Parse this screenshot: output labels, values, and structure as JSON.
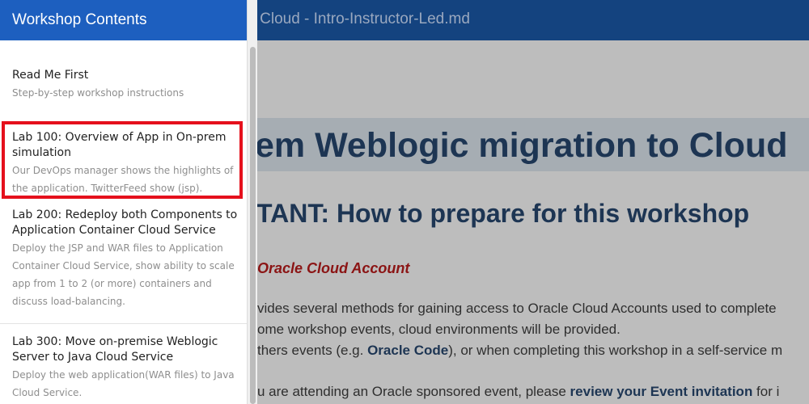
{
  "page": {
    "title": "to Cloud - Intro-Instructor-Led.md",
    "h1": "em Weblogic migration to Cloud",
    "h2": "TANT: How to prepare for this workshop",
    "h3": "Oracle Cloud Account",
    "p1": "vides several methods for gaining access to Oracle Cloud Accounts used to complete",
    "p2": "ome workshop events, cloud environments will be provided.",
    "p3_a": "thers events (e.g. ",
    "p3_b": "Oracle Code",
    "p3_c": "), or when completing this workshop in a self-service m",
    "p4_a": "u are attending an Oracle sponsored event, please ",
    "p4_b": "review your Event invitation",
    "p4_c": " for i"
  },
  "sidebar": {
    "header": "Workshop Contents",
    "items": [
      {
        "title": "Read Me First",
        "desc": "Step-by-step workshop instructions"
      },
      {
        "title": "Lab 100: Overview of App in On-prem simulation",
        "desc": "Our DevOps manager shows the highlights of the application. TwitterFeed show (jsp)."
      },
      {
        "title": "Lab 200: Redeploy both Components to Application Container Cloud Service",
        "desc": "Deploy the JSP and WAR files to Application Container Cloud Service, show ability to scale app from 1 to 2 (or more) containers and discuss load-balancing."
      },
      {
        "title": "Lab 300: Move on-premise Weblogic Server to Java Cloud Service",
        "desc": "Deploy the web application(WAR files) to Java Cloud Service."
      }
    ]
  },
  "colors": {
    "sidebar_header": "#1d5fbf",
    "topbar": "#14437f",
    "highlight": "#e5101c",
    "heading": "#1d3553",
    "subheading": "#8b1414"
  }
}
